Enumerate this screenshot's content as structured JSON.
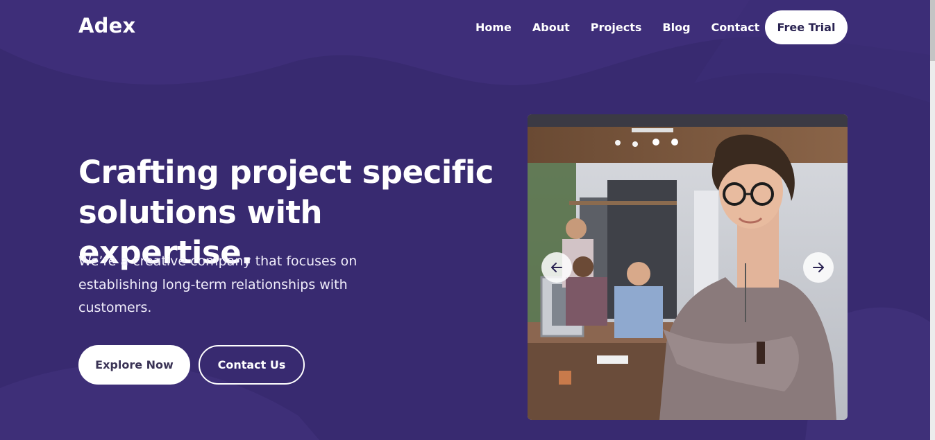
{
  "brand": {
    "logo_text": "Adex"
  },
  "nav": {
    "items": [
      {
        "label": "Home"
      },
      {
        "label": "About"
      },
      {
        "label": "Projects"
      },
      {
        "label": "Blog"
      },
      {
        "label": "Contact"
      }
    ],
    "cta_label": "Free Trial"
  },
  "hero": {
    "headline_line1": "Crafting project specific",
    "headline_line2": "solutions with expertise.",
    "subtext_line1": "We’re a creative company that focuses on",
    "subtext_line2": "establishing long-term relationships with",
    "subtext_line3": "customers.",
    "primary_button": "Explore Now",
    "secondary_button": "Contact Us"
  },
  "slider": {
    "prev_icon": "arrow-left-icon",
    "next_icon": "arrow-right-icon"
  },
  "colors": {
    "background": "#3a2a72",
    "button_text": "#2a2352",
    "white": "#ffffff"
  }
}
